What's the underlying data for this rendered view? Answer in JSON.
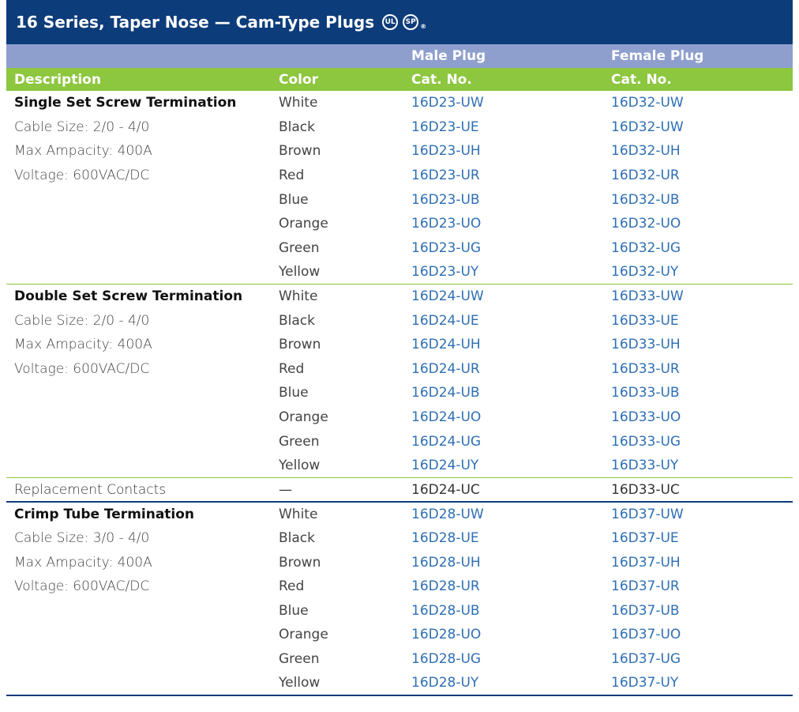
{
  "title": "16 Series, Taper Nose — Cam-Type Plugs",
  "certs": [
    "UL",
    "SP"
  ],
  "header_top": [
    "",
    "",
    "Male Plug",
    "Female Plug"
  ],
  "header": [
    "Description",
    "Color",
    "Cat. No.",
    "Cat. No."
  ],
  "groups": [
    {
      "desc": [
        "Single Set Screw Termination",
        "Cable Size: 2/0 - 4/0",
        "Max Ampacity: 400A",
        "Voltage: 600VAC/DC"
      ],
      "rows": [
        [
          "White",
          "16D23-UW",
          "16D32-UW"
        ],
        [
          "Black",
          "16D23-UE",
          "16D32-UW"
        ],
        [
          "Brown",
          "16D23-UH",
          "16D32-UH"
        ],
        [
          "Red",
          "16D23-UR",
          "16D32-UR"
        ],
        [
          "Blue",
          "16D23-UB",
          "16D32-UB"
        ],
        [
          "Orange",
          "16D23-UO",
          "16D32-UO"
        ],
        [
          "Green",
          "16D23-UG",
          "16D32-UG"
        ],
        [
          "Yellow",
          "16D23-UY",
          "16D32-UY"
        ]
      ]
    },
    {
      "desc": [
        "Double Set Screw Termination",
        "Cable Size: 2/0 - 4/0",
        "Max Ampacity: 400A",
        "Voltage: 600VAC/DC"
      ],
      "rows": [
        [
          "White",
          "16D24-UW",
          "16D33-UW"
        ],
        [
          "Black",
          "16D24-UE",
          "16D33-UE"
        ],
        [
          "Brown",
          "16D24-UH",
          "16D33-UH"
        ],
        [
          "Red",
          "16D24-UR",
          "16D33-UR"
        ],
        [
          "Blue",
          "16D24-UB",
          "16D33-UB"
        ],
        [
          "Orange",
          "16D24-UO",
          "16D33-UO"
        ],
        [
          "Green",
          "16D24-UG",
          "16D33-UG"
        ],
        [
          "Yellow",
          "16D24-UY",
          "16D33-UY"
        ]
      ]
    },
    {
      "desc": [
        "Crimp Tube Termination",
        "Cable Size: 3/0 - 4/0",
        "Max Ampacity: 400A",
        "Voltage: 600VAC/DC"
      ],
      "rows": [
        [
          "White",
          "16D28-UW",
          "16D37-UW"
        ],
        [
          "Black",
          "16D28-UE",
          "16D37-UE"
        ],
        [
          "Brown",
          "16D28-UH",
          "16D37-UH"
        ],
        [
          "Red",
          "16D28-UR",
          "16D37-UR"
        ],
        [
          "Blue",
          "16D28-UB",
          "16D37-UB"
        ],
        [
          "Orange",
          "16D28-UO",
          "16D37-UO"
        ],
        [
          "Green",
          "16D28-UG",
          "16D37-UG"
        ],
        [
          "Yellow",
          "16D28-UY",
          "16D37-UY"
        ]
      ]
    }
  ],
  "contacts_row": [
    "Replacement Contacts",
    "—",
    "16D24-UC",
    "16D33-UC"
  ],
  "colors": {
    "title_bg": "#0d3c7a",
    "subheader_bg": "#8f9fcd",
    "header_bg": "#8dc63f",
    "catalog_text": "#2e6fb4"
  }
}
